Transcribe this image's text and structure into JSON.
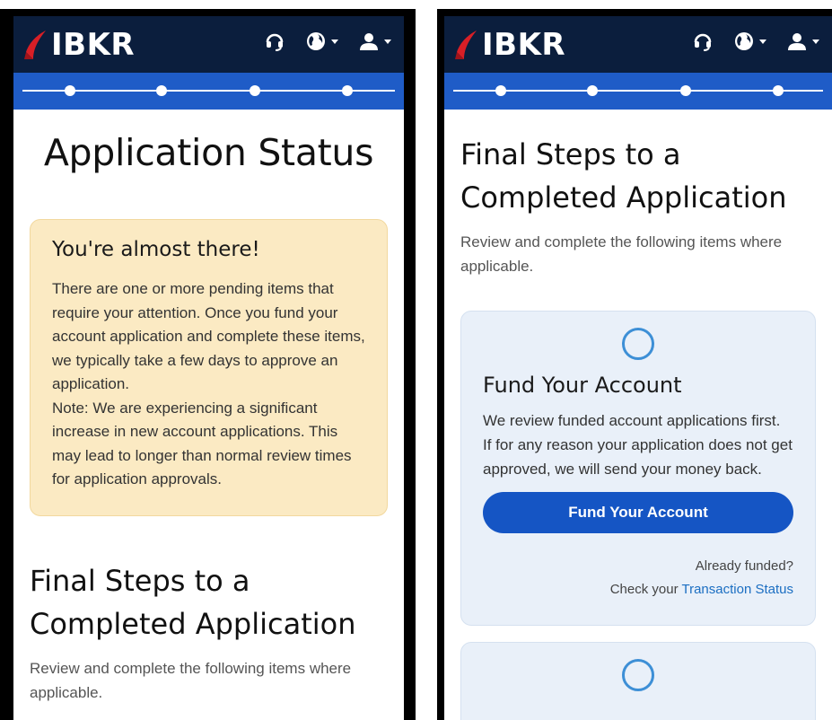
{
  "brand": {
    "name": "IBKR",
    "logo_color": "#d81f26",
    "nav_color": "#0b1e3d",
    "progress_color": "#1f5cc7"
  },
  "header_icons": [
    "headset-icon",
    "globe-icon",
    "user-icon"
  ],
  "left_screen": {
    "page_title": "Application Status",
    "alert": {
      "title": "You're almost there!",
      "body": "There are one or more pending items that require your attention. Once you fund your account application and complete these items, we typically take a few days to approve an application.",
      "note": "Note: We are experiencing a significant increase in new account applications. This may lead to longer than normal review times for application approvals."
    },
    "section_title": "Final Steps to a Completed Application",
    "section_subtitle": "Review and complete the following items where applicable."
  },
  "right_screen": {
    "section_title": "Final Steps to a Completed Application",
    "section_subtitle": "Review and complete the following items where applicable.",
    "fund_card": {
      "title": "Fund Your Account",
      "text_1": "We review funded account applications first.",
      "text_2": "If for any reason your application does not get approved, we will send your money back.",
      "button_label": "Fund Your Account",
      "already_funded": "Already funded?",
      "check_prefix": "Check your",
      "transaction_link": "Transaction Status"
    }
  }
}
